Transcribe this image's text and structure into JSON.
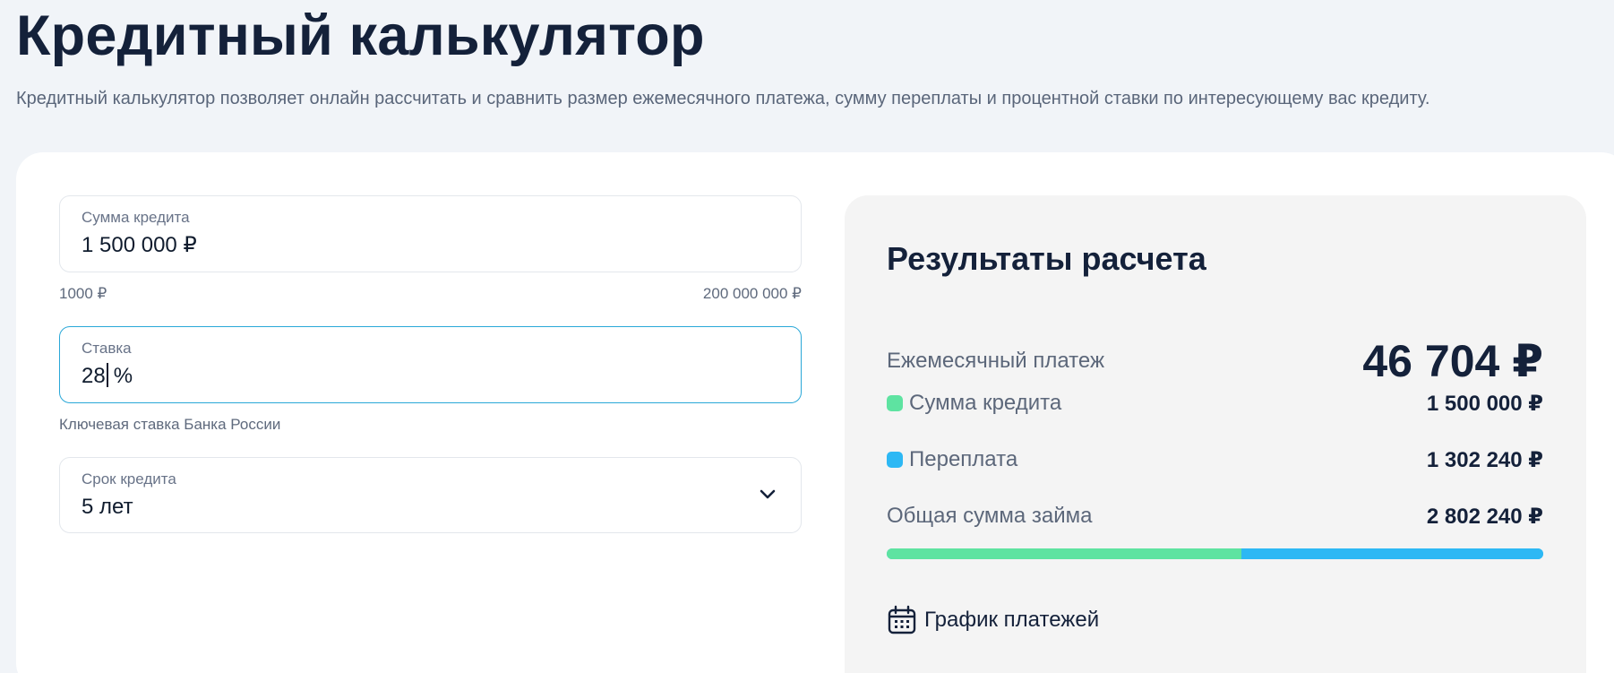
{
  "header": {
    "title": "Кредитный калькулятор",
    "subtitle": "Кредитный калькулятор позволяет онлайн рассчитать и сравнить размер ежемесячного платежа, сумму переплаты и процентной ставки по интересующему вас кредиту."
  },
  "form": {
    "amount": {
      "label": "Сумма кредита",
      "value": "1 500 000 ₽",
      "min": "1000 ₽",
      "max": "200 000 000 ₽"
    },
    "rate": {
      "label": "Ставка",
      "value": "28",
      "unit": "%",
      "hint": "Ключевая ставка Банка России"
    },
    "term": {
      "label": "Срок кредита",
      "value": "5 лет"
    }
  },
  "results": {
    "title": "Результаты расчета",
    "monthly": {
      "label": "Ежемесячный платеж",
      "value": "46 704 ₽"
    },
    "principal": {
      "label": "Сумма кредита",
      "value": "1 500 000 ₽",
      "color": "#5ee3a1"
    },
    "overpay": {
      "label": "Переплата",
      "value": "1 302 240 ₽",
      "color": "#2db8f4"
    },
    "total": {
      "label": "Общая сумма займа",
      "value": "2 802 240 ₽"
    },
    "progress": {
      "principal_fraction": 0.54
    },
    "schedule_link": "График платежей"
  },
  "colors": {
    "accent": "#2aa8d8",
    "principal": "#5ee3a1",
    "overpay": "#2db8f4"
  }
}
